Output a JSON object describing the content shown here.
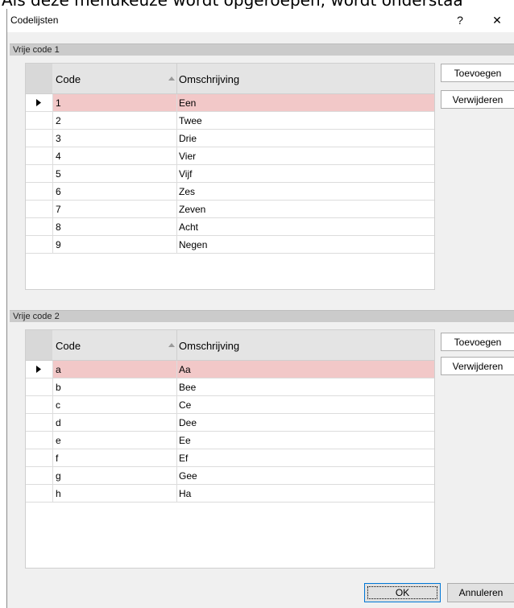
{
  "background_caption": "Als deze menukeuze wordt opgeroepen, wordt onderstaa",
  "dialog": {
    "title": "Codelijsten",
    "help_label": "?",
    "close_label": "✕",
    "ok_label": "OK",
    "cancel_label": "Annuleren"
  },
  "group1": {
    "header": "Vrije code 1",
    "col_code": "Code",
    "col_desc": "Omschrijving",
    "add_label": "Toevoegen",
    "remove_label": "Verwijderen",
    "rows": [
      {
        "code": "1",
        "desc": "Een"
      },
      {
        "code": "2",
        "desc": "Twee"
      },
      {
        "code": "3",
        "desc": "Drie"
      },
      {
        "code": "4",
        "desc": "Vier"
      },
      {
        "code": "5",
        "desc": "Vijf"
      },
      {
        "code": "6",
        "desc": "Zes"
      },
      {
        "code": "7",
        "desc": "Zeven"
      },
      {
        "code": "8",
        "desc": "Acht"
      },
      {
        "code": "9",
        "desc": "Negen"
      }
    ]
  },
  "group2": {
    "header": "Vrije code 2",
    "col_code": "Code",
    "col_desc": "Omschrijving",
    "add_label": "Toevoegen",
    "remove_label": "Verwijderen",
    "rows": [
      {
        "code": "a",
        "desc": "Aa"
      },
      {
        "code": "b",
        "desc": "Bee"
      },
      {
        "code": "c",
        "desc": "Ce"
      },
      {
        "code": "d",
        "desc": "Dee"
      },
      {
        "code": "e",
        "desc": "Ee"
      },
      {
        "code": "f",
        "desc": "Ef"
      },
      {
        "code": "g",
        "desc": "Gee"
      },
      {
        "code": "h",
        "desc": "Ha"
      }
    ]
  }
}
